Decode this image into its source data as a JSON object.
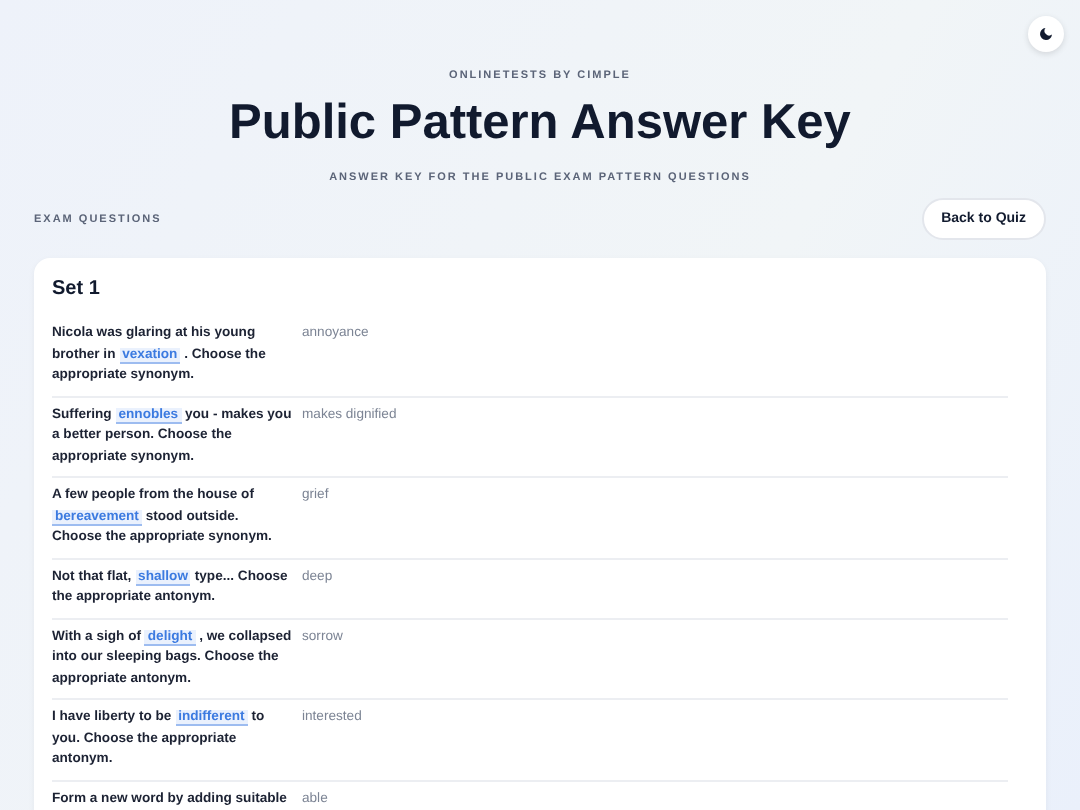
{
  "brand": "ONLINETESTS BY CIMPLE",
  "title": "Public Pattern Answer Key",
  "subtitle": "ANSWER KEY FOR THE PUBLIC EXAM PATTERN QUESTIONS",
  "section_label": "EXAM QUESTIONS",
  "back_button": "Back to Quiz",
  "set": {
    "title": "Set 1",
    "rows": [
      {
        "before": "Nicola was glaring at his young brother in",
        "term": "vexation",
        "after": ". Choose the appropriate synonym.",
        "answer": "annoyance"
      },
      {
        "before": "Suffering",
        "term": "ennobles",
        "after": "you - makes you a better person. Choose the appropriate synonym.",
        "answer": "makes dignified"
      },
      {
        "before": "A few people from the house of",
        "term": "bereavement",
        "after": "stood outside. Choose the appropriate synonym.",
        "answer": "grief"
      },
      {
        "before": "Not that flat,",
        "term": "shallow",
        "after": "type... Choose the appropriate antonym.",
        "answer": "deep"
      },
      {
        "before": "With a sigh of",
        "term": "delight",
        "after": ", we collapsed into our sleeping bags. Choose the appropriate antonym.",
        "answer": "sorrow"
      },
      {
        "before": "I have liberty to be",
        "term": "indifferent",
        "after": "to you. Choose the appropriate antonym.",
        "answer": "interested"
      },
      {
        "before": "Form a new word by adding suitable",
        "answer": "able"
      }
    ]
  }
}
